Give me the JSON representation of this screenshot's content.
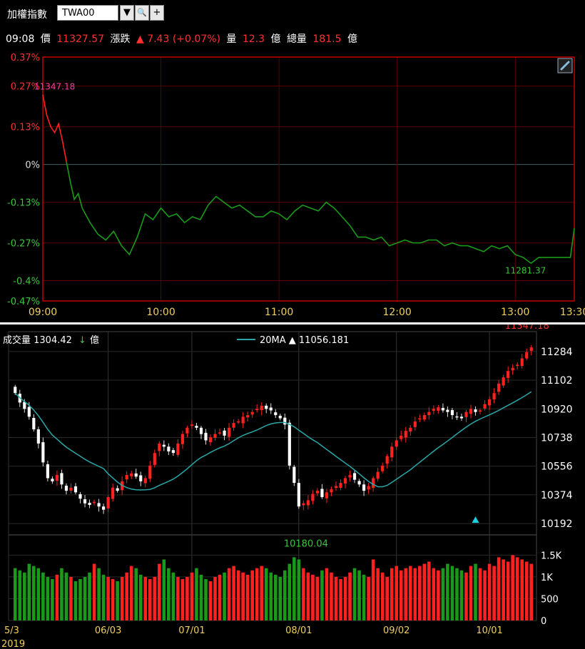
{
  "header": {
    "title": "加權指數",
    "code": "TWA00",
    "buttons": {
      "dropdown": "▼",
      "search": "🔍",
      "add": "+"
    }
  },
  "quote": {
    "time": "09:08",
    "price_label": "價",
    "price": "11327.57",
    "change_label": "漲跌",
    "change": "▲ 7.43 (+0.07%)",
    "volume_label": "量",
    "volume": "12.3",
    "unit": "億",
    "total_label": "總量",
    "total": "181.5"
  },
  "colors": {
    "up": "#ff2020",
    "down": "#1a9a1a",
    "ma": "#2aa7a7",
    "grid": "#5a0000",
    "axis": "#c00000"
  },
  "chart_data": [
    {
      "type": "line",
      "y_ticks": [
        "0.37%",
        "0.27%",
        "0.13%",
        "0%",
        "-0.13%",
        "-0.27%",
        "-0.4%",
        "-0.47%"
      ],
      "y_tick_values": [
        0.37,
        0.27,
        0.13,
        0,
        -0.13,
        -0.27,
        -0.4,
        -0.47
      ],
      "x_ticks": [
        "09:00",
        "10:00",
        "11:00",
        "12:00",
        "13:00",
        "13:30"
      ],
      "x_tick_minutes": [
        0,
        60,
        120,
        180,
        240,
        270
      ],
      "ylim": [
        -0.47,
        0.37
      ],
      "xlim": [
        0,
        270
      ],
      "high_label": "11347.18",
      "low_label": "11281.37",
      "icon": "link-icon",
      "x": [
        0,
        2,
        4,
        6,
        8,
        10,
        12,
        14,
        16,
        18,
        20,
        24,
        28,
        32,
        36,
        40,
        44,
        48,
        52,
        56,
        60,
        64,
        68,
        72,
        76,
        80,
        84,
        88,
        92,
        96,
        100,
        104,
        108,
        112,
        116,
        120,
        124,
        128,
        132,
        136,
        140,
        144,
        148,
        152,
        156,
        160,
        164,
        168,
        172,
        176,
        180,
        184,
        188,
        192,
        196,
        200,
        204,
        208,
        212,
        216,
        220,
        224,
        228,
        232,
        236,
        240,
        244,
        248,
        252,
        256,
        260,
        264,
        268,
        270
      ],
      "y": [
        0.24,
        0.17,
        0.13,
        0.11,
        0.14,
        0.08,
        0.01,
        -0.06,
        -0.12,
        -0.1,
        -0.15,
        -0.2,
        -0.24,
        -0.26,
        -0.23,
        -0.28,
        -0.31,
        -0.25,
        -0.17,
        -0.19,
        -0.15,
        -0.18,
        -0.17,
        -0.2,
        -0.18,
        -0.19,
        -0.14,
        -0.11,
        -0.13,
        -0.15,
        -0.14,
        -0.16,
        -0.18,
        -0.18,
        -0.16,
        -0.17,
        -0.19,
        -0.16,
        -0.14,
        -0.15,
        -0.16,
        -0.13,
        -0.15,
        -0.18,
        -0.21,
        -0.25,
        -0.25,
        -0.26,
        -0.25,
        -0.28,
        -0.27,
        -0.26,
        -0.27,
        -0.27,
        -0.26,
        -0.26,
        -0.28,
        -0.27,
        -0.28,
        -0.28,
        -0.29,
        -0.3,
        -0.28,
        -0.29,
        -0.28,
        -0.31,
        -0.32,
        -0.34,
        -0.32,
        -0.32,
        -0.32,
        -0.32,
        -0.32,
        -0.22
      ]
    },
    {
      "type": "candlestick",
      "volume_label": "成交量",
      "volume_value": "1304.42",
      "volume_arrow": "↓",
      "volume_unit": "億",
      "ma_label": "20MA",
      "ma_value": "▲ 11056.181",
      "y_ticks": [
        "11284",
        "11102",
        "10920",
        "10738",
        "10556",
        "10374",
        "10192"
      ],
      "y_tick_values": [
        11284,
        11102,
        10920,
        10738,
        10556,
        10374,
        10192
      ],
      "ylim": [
        10120,
        11410
      ],
      "volume_ticks": [
        "1.5K",
        "1K",
        "500",
        "0"
      ],
      "volume_tick_values": [
        1500,
        1000,
        500,
        0
      ],
      "volume_ylim": [
        0,
        1800
      ],
      "x_ticks": [
        "5/3",
        "06/03",
        "07/01",
        "08/01",
        "09/02",
        "10/01"
      ],
      "x_tick_index": [
        0,
        20,
        38,
        61,
        82,
        102
      ],
      "year_label": "2019",
      "high_label": "11347.18",
      "low_label": "10180.04",
      "close": [
        11020,
        10960,
        10920,
        10870,
        10790,
        10700,
        10580,
        10480,
        10460,
        10500,
        10440,
        10400,
        10420,
        10390,
        10350,
        10320,
        10310,
        10330,
        10300,
        10280,
        10360,
        10420,
        10400,
        10460,
        10500,
        10510,
        10490,
        10460,
        10480,
        10560,
        10640,
        10700,
        10680,
        10650,
        10640,
        10700,
        10760,
        10800,
        10820,
        10800,
        10760,
        10720,
        10740,
        10760,
        10770,
        10750,
        10800,
        10830,
        10840,
        10870,
        10880,
        10900,
        10920,
        10940,
        10920,
        10910,
        10880,
        10860,
        10820,
        10560,
        10450,
        10300,
        10320,
        10340,
        10380,
        10400,
        10360,
        10390,
        10410,
        10430,
        10450,
        10480,
        10500,
        10470,
        10440,
        10400,
        10430,
        10480,
        10520,
        10560,
        10620,
        10680,
        10720,
        10750,
        10780,
        10800,
        10840,
        10860,
        10880,
        10900,
        10920,
        10930,
        10910,
        10900,
        10880,
        10870,
        10860,
        10900,
        10920,
        10900,
        10910,
        10950,
        10980,
        11020,
        11080,
        11120,
        11160,
        11180,
        11200,
        11240,
        11280,
        11310
      ],
      "volume": [
        1200,
        1150,
        1100,
        1300,
        1250,
        1200,
        1100,
        1000,
        950,
        1050,
        1200,
        1100,
        1000,
        900,
        950,
        1000,
        1100,
        1300,
        1200,
        1050,
        1000,
        950,
        900,
        1000,
        1100,
        1250,
        1200,
        1050,
        1000,
        950,
        1000,
        1300,
        1400,
        1200,
        1100,
        1000,
        950,
        1000,
        1100,
        1200,
        1050,
        950,
        900,
        1000,
        1050,
        1100,
        1200,
        1250,
        1150,
        1100,
        1050,
        1150,
        1200,
        1250,
        1200,
        1100,
        1050,
        1000,
        1150,
        1300,
        1450,
        1400,
        1200,
        1100,
        1050,
        1000,
        1150,
        1200,
        1100,
        1000,
        950,
        1000,
        1100,
        1200,
        1150,
        1050,
        1000,
        1400,
        1200,
        1100,
        1000,
        1200,
        1250,
        1150,
        1200,
        1250,
        1200,
        1250,
        1300,
        1350,
        1200,
        1150,
        1200,
        1300,
        1250,
        1200,
        1150,
        1100,
        1250,
        1300,
        1200,
        1150,
        1300,
        1250,
        1450,
        1400,
        1350,
        1500,
        1450,
        1400,
        1350,
        1300,
        1250
      ]
    }
  ]
}
